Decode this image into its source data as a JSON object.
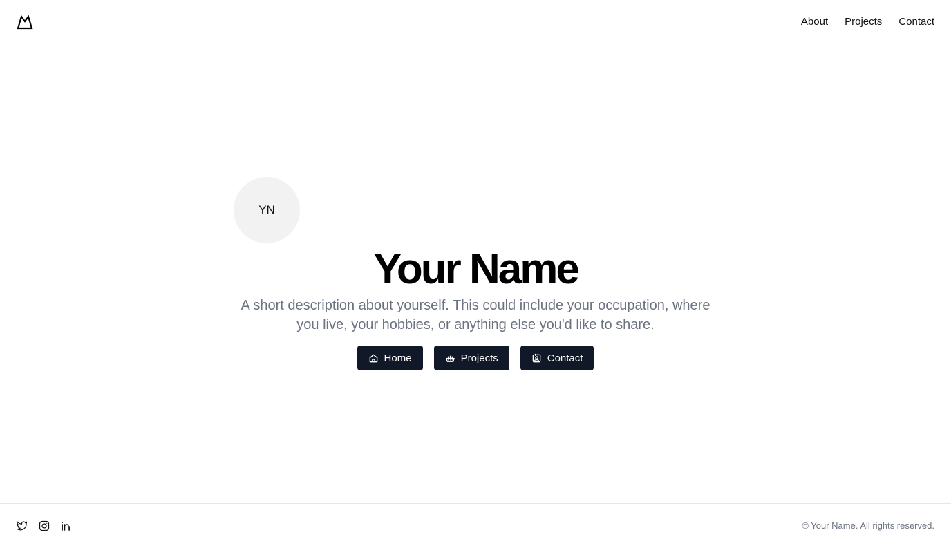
{
  "header": {
    "logo_icon": "mountain-icon",
    "nav": [
      {
        "label": "About"
      },
      {
        "label": "Projects"
      },
      {
        "label": "Contact"
      }
    ]
  },
  "hero": {
    "avatar_initials": "YN",
    "name": "Your Name",
    "description": "A short description about yourself. This could include your occupation, where you live, your hobbies, or anything else you'd like to share.",
    "buttons": [
      {
        "label": "Home",
        "icon": "home-icon"
      },
      {
        "label": "Projects",
        "icon": "projects-icon"
      },
      {
        "label": "Contact",
        "icon": "contact-icon"
      }
    ]
  },
  "footer": {
    "social": [
      {
        "icon": "twitter-icon"
      },
      {
        "icon": "instagram-icon"
      },
      {
        "icon": "linkedin-icon"
      }
    ],
    "copyright": "© Your Name. All rights reserved."
  },
  "colors": {
    "button_bg": "#111827",
    "muted_text": "#6b7280",
    "avatar_bg": "#f2f2f2"
  }
}
